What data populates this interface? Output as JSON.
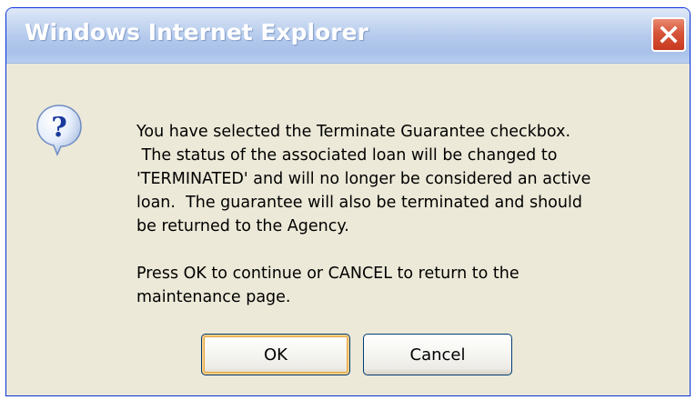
{
  "window": {
    "title": "Windows Internet Explorer"
  },
  "icons": {
    "close": "close-icon",
    "message": "question-icon"
  },
  "message": {
    "paragraph1": "You have selected the Terminate Guarantee checkbox.\n The status of the associated loan will be changed to\n'TERMINATED' and will no longer be considered an active\nloan.  The guarantee will also be terminated and should\nbe returned to the Agency.",
    "paragraph2": "Press OK to continue or CANCEL to return to the\nmaintenance page."
  },
  "buttons": {
    "ok_label": "OK",
    "cancel_label": "Cancel"
  },
  "colors": {
    "dialog_background": "#ece9d8",
    "title_text": "#ffffff",
    "close_button": "#d5553a",
    "default_button_highlight": "#f6cd86"
  }
}
